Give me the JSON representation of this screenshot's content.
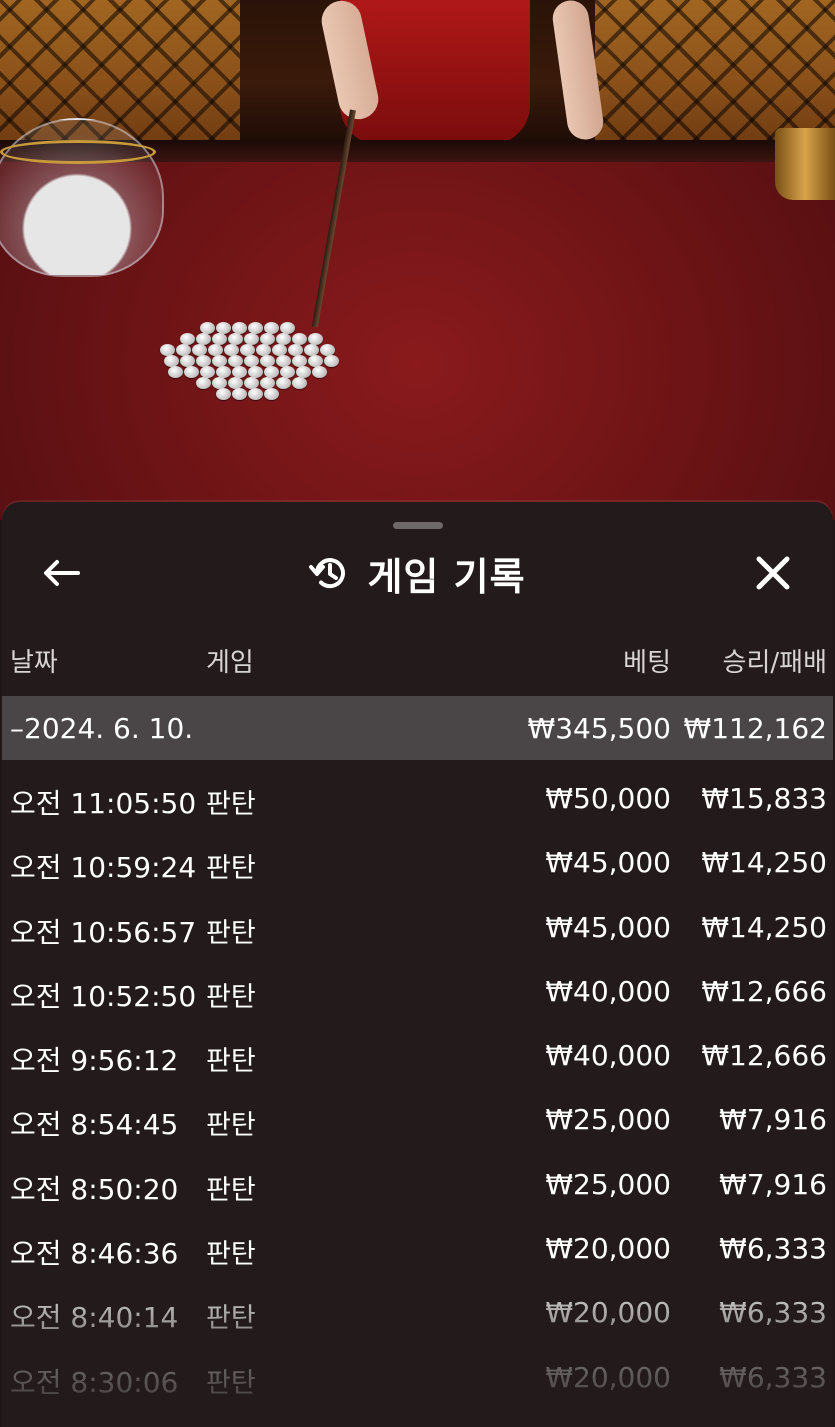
{
  "scene": {
    "description_icon": "live-dealer-video"
  },
  "sheet": {
    "title": "게임 기록",
    "back_icon": "arrow-left-icon",
    "history_icon": "history-icon",
    "close_icon": "close-icon"
  },
  "columns": {
    "date": "날짜",
    "game": "게임",
    "bet": "베팅",
    "win_loss": "승리/패배"
  },
  "date_group": {
    "label": "–2024. 6. 10.",
    "bet_total": "₩345,500",
    "win_total": "₩112,162"
  },
  "records": [
    {
      "time": "오전 11:05:50",
      "game": "판탄",
      "bet": "₩50,000",
      "win": "₩15,833"
    },
    {
      "time": "오전 10:59:24",
      "game": "판탄",
      "bet": "₩45,000",
      "win": "₩14,250"
    },
    {
      "time": "오전 10:56:57",
      "game": "판탄",
      "bet": "₩45,000",
      "win": "₩14,250"
    },
    {
      "time": "오전 10:52:50",
      "game": "판탄",
      "bet": "₩40,000",
      "win": "₩12,666"
    },
    {
      "time": "오전 9:56:12",
      "game": "판탄",
      "bet": "₩40,000",
      "win": "₩12,666"
    },
    {
      "time": "오전 8:54:45",
      "game": "판탄",
      "bet": "₩25,000",
      "win": "₩7,916"
    },
    {
      "time": "오전 8:50:20",
      "game": "판탄",
      "bet": "₩25,000",
      "win": "₩7,916"
    },
    {
      "time": "오전 8:46:36",
      "game": "판탄",
      "bet": "₩20,000",
      "win": "₩6,333"
    },
    {
      "time": "오전 8:40:14",
      "game": "판탄",
      "bet": "₩20,000",
      "win": "₩6,333"
    },
    {
      "time": "오전 8:30:06",
      "game": "판탄",
      "bet": "₩20,000",
      "win": "₩6,333"
    }
  ],
  "colors": {
    "sheet_bg": "#221a1b",
    "date_row_bg": "#4a4546",
    "table_felt": "#6e1416"
  }
}
